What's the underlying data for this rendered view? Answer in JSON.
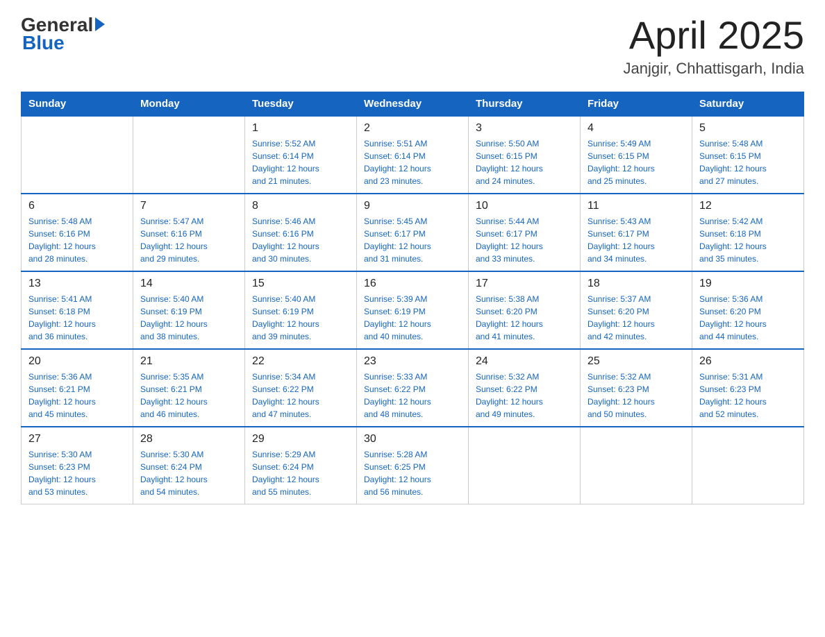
{
  "header": {
    "logo_general": "General",
    "logo_blue": "Blue",
    "title": "April 2025",
    "subtitle": "Janjgir, Chhattisgarh, India"
  },
  "weekdays": [
    "Sunday",
    "Monday",
    "Tuesday",
    "Wednesday",
    "Thursday",
    "Friday",
    "Saturday"
  ],
  "weeks": [
    [
      {
        "day": "",
        "info": ""
      },
      {
        "day": "",
        "info": ""
      },
      {
        "day": "1",
        "info": "Sunrise: 5:52 AM\nSunset: 6:14 PM\nDaylight: 12 hours\nand 21 minutes."
      },
      {
        "day": "2",
        "info": "Sunrise: 5:51 AM\nSunset: 6:14 PM\nDaylight: 12 hours\nand 23 minutes."
      },
      {
        "day": "3",
        "info": "Sunrise: 5:50 AM\nSunset: 6:15 PM\nDaylight: 12 hours\nand 24 minutes."
      },
      {
        "day": "4",
        "info": "Sunrise: 5:49 AM\nSunset: 6:15 PM\nDaylight: 12 hours\nand 25 minutes."
      },
      {
        "day": "5",
        "info": "Sunrise: 5:48 AM\nSunset: 6:15 PM\nDaylight: 12 hours\nand 27 minutes."
      }
    ],
    [
      {
        "day": "6",
        "info": "Sunrise: 5:48 AM\nSunset: 6:16 PM\nDaylight: 12 hours\nand 28 minutes."
      },
      {
        "day": "7",
        "info": "Sunrise: 5:47 AM\nSunset: 6:16 PM\nDaylight: 12 hours\nand 29 minutes."
      },
      {
        "day": "8",
        "info": "Sunrise: 5:46 AM\nSunset: 6:16 PM\nDaylight: 12 hours\nand 30 minutes."
      },
      {
        "day": "9",
        "info": "Sunrise: 5:45 AM\nSunset: 6:17 PM\nDaylight: 12 hours\nand 31 minutes."
      },
      {
        "day": "10",
        "info": "Sunrise: 5:44 AM\nSunset: 6:17 PM\nDaylight: 12 hours\nand 33 minutes."
      },
      {
        "day": "11",
        "info": "Sunrise: 5:43 AM\nSunset: 6:17 PM\nDaylight: 12 hours\nand 34 minutes."
      },
      {
        "day": "12",
        "info": "Sunrise: 5:42 AM\nSunset: 6:18 PM\nDaylight: 12 hours\nand 35 minutes."
      }
    ],
    [
      {
        "day": "13",
        "info": "Sunrise: 5:41 AM\nSunset: 6:18 PM\nDaylight: 12 hours\nand 36 minutes."
      },
      {
        "day": "14",
        "info": "Sunrise: 5:40 AM\nSunset: 6:19 PM\nDaylight: 12 hours\nand 38 minutes."
      },
      {
        "day": "15",
        "info": "Sunrise: 5:40 AM\nSunset: 6:19 PM\nDaylight: 12 hours\nand 39 minutes."
      },
      {
        "day": "16",
        "info": "Sunrise: 5:39 AM\nSunset: 6:19 PM\nDaylight: 12 hours\nand 40 minutes."
      },
      {
        "day": "17",
        "info": "Sunrise: 5:38 AM\nSunset: 6:20 PM\nDaylight: 12 hours\nand 41 minutes."
      },
      {
        "day": "18",
        "info": "Sunrise: 5:37 AM\nSunset: 6:20 PM\nDaylight: 12 hours\nand 42 minutes."
      },
      {
        "day": "19",
        "info": "Sunrise: 5:36 AM\nSunset: 6:20 PM\nDaylight: 12 hours\nand 44 minutes."
      }
    ],
    [
      {
        "day": "20",
        "info": "Sunrise: 5:36 AM\nSunset: 6:21 PM\nDaylight: 12 hours\nand 45 minutes."
      },
      {
        "day": "21",
        "info": "Sunrise: 5:35 AM\nSunset: 6:21 PM\nDaylight: 12 hours\nand 46 minutes."
      },
      {
        "day": "22",
        "info": "Sunrise: 5:34 AM\nSunset: 6:22 PM\nDaylight: 12 hours\nand 47 minutes."
      },
      {
        "day": "23",
        "info": "Sunrise: 5:33 AM\nSunset: 6:22 PM\nDaylight: 12 hours\nand 48 minutes."
      },
      {
        "day": "24",
        "info": "Sunrise: 5:32 AM\nSunset: 6:22 PM\nDaylight: 12 hours\nand 49 minutes."
      },
      {
        "day": "25",
        "info": "Sunrise: 5:32 AM\nSunset: 6:23 PM\nDaylight: 12 hours\nand 50 minutes."
      },
      {
        "day": "26",
        "info": "Sunrise: 5:31 AM\nSunset: 6:23 PM\nDaylight: 12 hours\nand 52 minutes."
      }
    ],
    [
      {
        "day": "27",
        "info": "Sunrise: 5:30 AM\nSunset: 6:23 PM\nDaylight: 12 hours\nand 53 minutes."
      },
      {
        "day": "28",
        "info": "Sunrise: 5:30 AM\nSunset: 6:24 PM\nDaylight: 12 hours\nand 54 minutes."
      },
      {
        "day": "29",
        "info": "Sunrise: 5:29 AM\nSunset: 6:24 PM\nDaylight: 12 hours\nand 55 minutes."
      },
      {
        "day": "30",
        "info": "Sunrise: 5:28 AM\nSunset: 6:25 PM\nDaylight: 12 hours\nand 56 minutes."
      },
      {
        "day": "",
        "info": ""
      },
      {
        "day": "",
        "info": ""
      },
      {
        "day": "",
        "info": ""
      }
    ]
  ]
}
